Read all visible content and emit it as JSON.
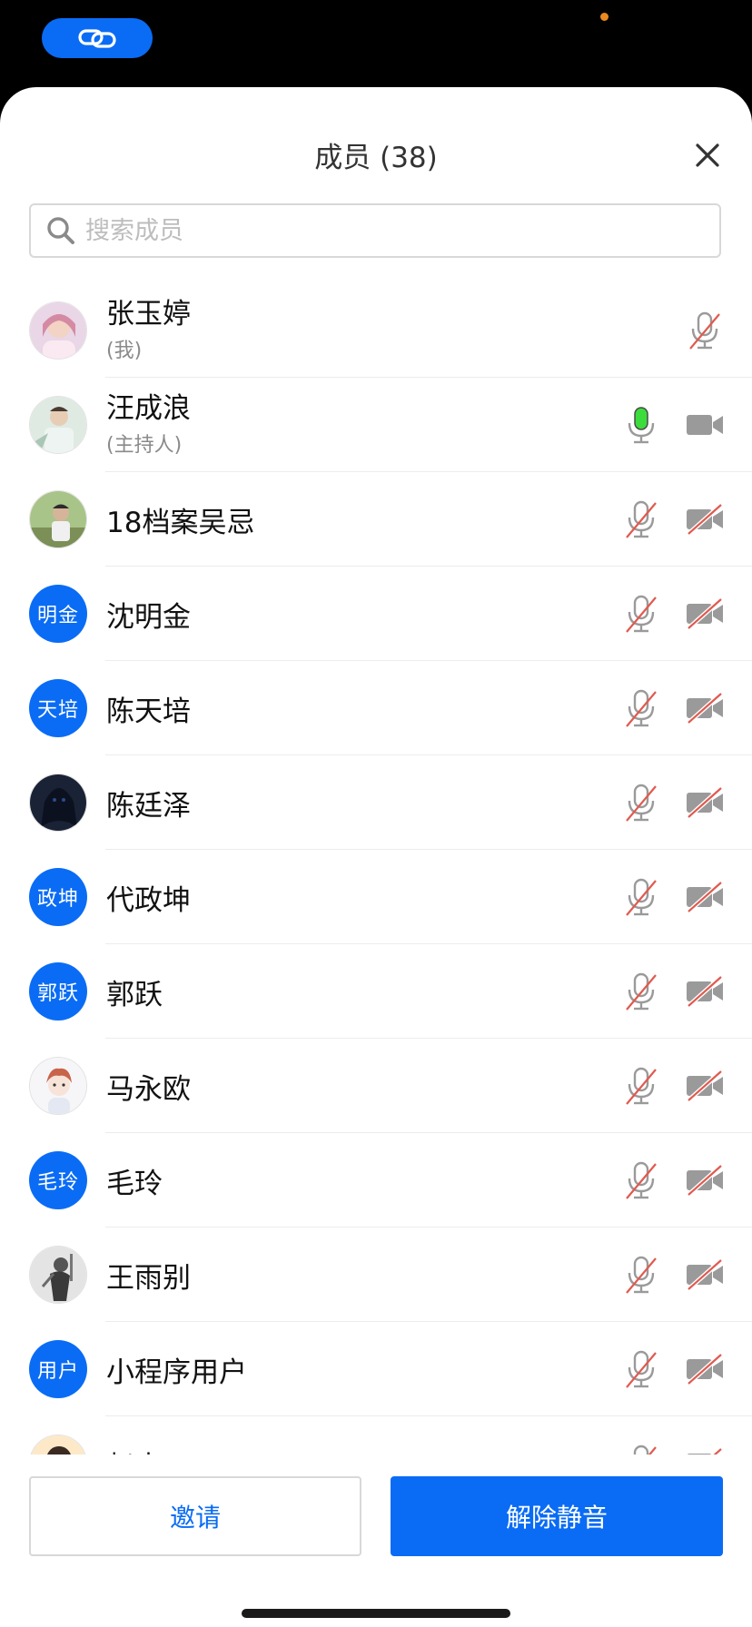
{
  "status_bar": {
    "link_icon": "link-icon"
  },
  "header": {
    "title": "成员 (38)",
    "close_icon": "close-icon"
  },
  "search": {
    "placeholder": "搜索成员",
    "value": "",
    "icon": "search-icon"
  },
  "members": [
    {
      "name": "张玉婷",
      "sub": "(我)",
      "avatar": "photo",
      "mic": "muted",
      "cam": "none"
    },
    {
      "name": "汪成浪",
      "sub": "(主持人)",
      "avatar": "photo",
      "mic": "active",
      "cam": "on"
    },
    {
      "name": "18档案吴忌",
      "avatar": "photo",
      "mic": "muted",
      "cam": "off"
    },
    {
      "name": "沈明金",
      "avatar_text": "明金",
      "avatar": "text",
      "mic": "muted",
      "cam": "off"
    },
    {
      "name": "陈天培",
      "avatar_text": "天培",
      "avatar": "text",
      "mic": "muted",
      "cam": "off"
    },
    {
      "name": "陈廷泽",
      "avatar": "photo",
      "mic": "muted",
      "cam": "off"
    },
    {
      "name": "代政坤",
      "avatar_text": "政坤",
      "avatar": "text",
      "mic": "muted",
      "cam": "off"
    },
    {
      "name": "郭跃",
      "avatar_text": "郭跃",
      "avatar": "text",
      "mic": "muted",
      "cam": "off"
    },
    {
      "name": "马永欧",
      "avatar": "photo",
      "mic": "muted",
      "cam": "off"
    },
    {
      "name": "毛玲",
      "avatar_text": "毛玲",
      "avatar": "text",
      "mic": "muted",
      "cam": "off"
    },
    {
      "name": "王雨别",
      "avatar": "photo",
      "mic": "muted",
      "cam": "off"
    },
    {
      "name": "小程序用户",
      "avatar_text": "用户",
      "avatar": "text",
      "mic": "muted",
      "cam": "off"
    },
    {
      "name": "赵杰",
      "avatar": "photo",
      "mic": "muted",
      "cam": "off"
    }
  ],
  "actions": {
    "invite_label": "邀请",
    "unmute_label": "解除静音"
  },
  "colors": {
    "accent": "#0a6cf5",
    "mic_active": "#3ddc3d",
    "muted_slash": "#e05a4f",
    "icon_gray": "#9a9a9a"
  }
}
